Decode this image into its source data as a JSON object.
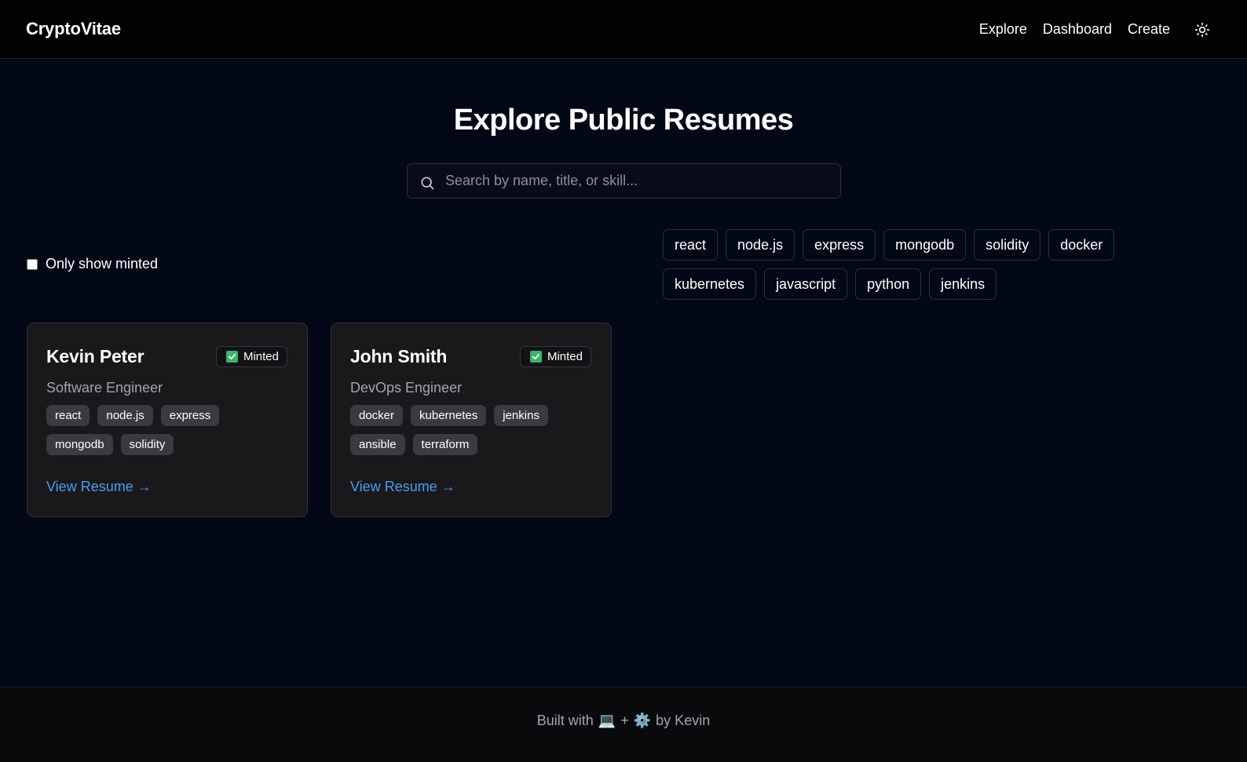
{
  "header": {
    "brand": "CryptoVitae",
    "nav": [
      {
        "label": "Explore"
      },
      {
        "label": "Dashboard"
      },
      {
        "label": "Create"
      }
    ],
    "theme_icon": "sun-icon"
  },
  "main": {
    "title": "Explore Public Resumes",
    "search": {
      "placeholder": "Search by name, title, or skill...",
      "value": "",
      "icon": "search-icon"
    },
    "filter": {
      "label": "Only show minted",
      "checked": false
    },
    "skill_filters": [
      "react",
      "node.js",
      "express",
      "mongodb",
      "solidity",
      "docker",
      "kubernetes",
      "javascript",
      "python",
      "jenkins"
    ],
    "cards": [
      {
        "name": "Kevin Peter",
        "badge": "Minted",
        "title": "Software Engineer",
        "tags": [
          "react",
          "node.js",
          "express",
          "mongodb",
          "solidity"
        ],
        "link": "View Resume →"
      },
      {
        "name": "John Smith",
        "badge": "Minted",
        "title": "DevOps Engineer",
        "tags": [
          "docker",
          "kubernetes",
          "jenkins",
          "ansible",
          "terraform"
        ],
        "link": "View Resume →"
      }
    ]
  },
  "footer": {
    "prefix": "Built with",
    "emoji1": "💻",
    "plus": "+",
    "emoji2": "⚙️",
    "suffix": "by Kevin"
  },
  "colors": {
    "background": "#030816",
    "card": "#19191c",
    "accent_link": "#4b9cf2",
    "minted_check": "#3cb46e"
  }
}
